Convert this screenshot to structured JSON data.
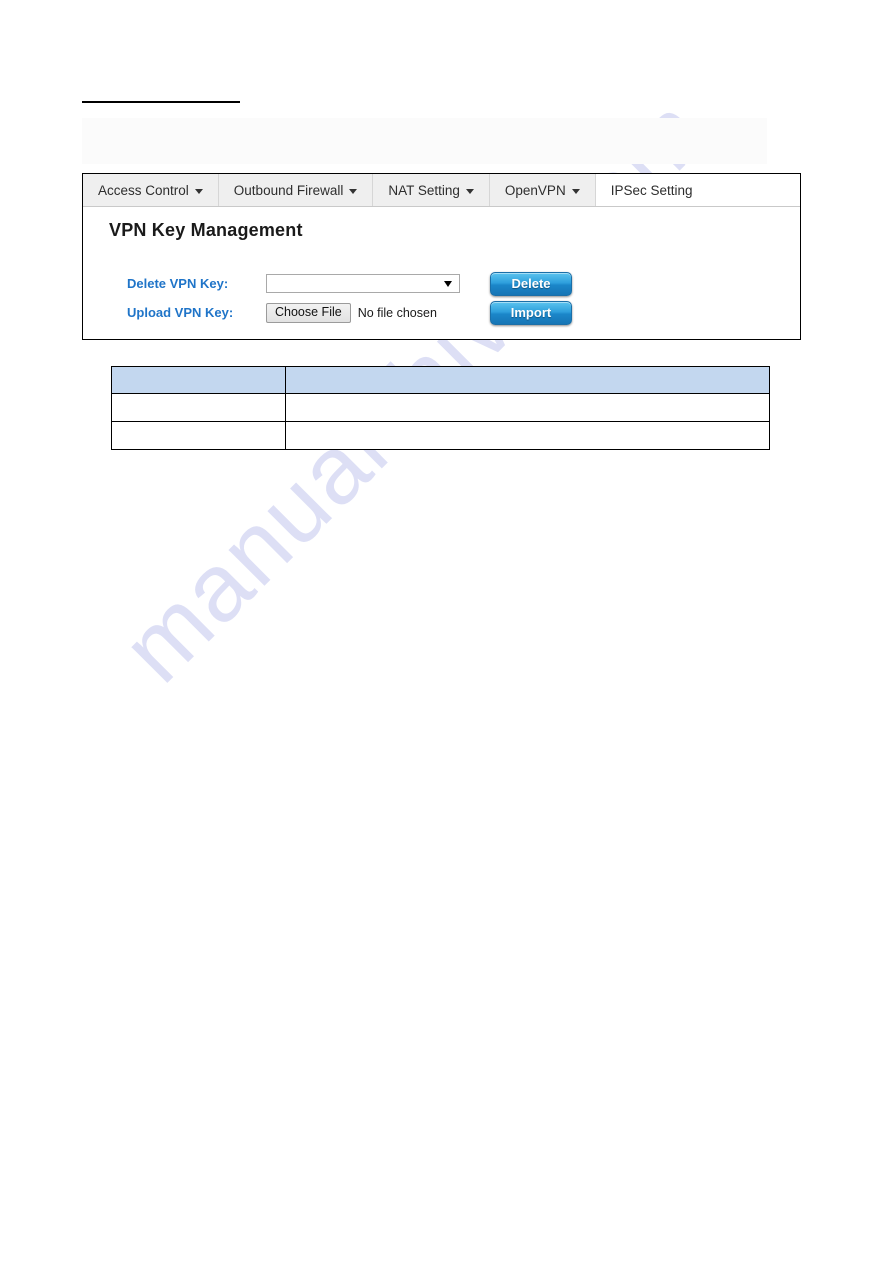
{
  "page": {
    "heading_rule": true,
    "watermark_text": "manualshive.com",
    "watermark_color": "#c9cdf0"
  },
  "panel": {
    "section_title": "VPN Key Management",
    "accent_label_color": "#1f74c8",
    "button_color": "#2e9fdc",
    "tabs": [
      {
        "label": "Access Control",
        "has_caret": true,
        "active": false
      },
      {
        "label": "Outbound Firewall",
        "has_caret": true,
        "active": false
      },
      {
        "label": "NAT Setting",
        "has_caret": true,
        "active": false
      },
      {
        "label": "OpenVPN",
        "has_caret": true,
        "active": false
      },
      {
        "label": "IPSec Setting",
        "has_caret": false,
        "active": true
      }
    ],
    "form": {
      "delete_row": {
        "label": "Delete VPN Key:",
        "select_value": "",
        "button_label": "Delete"
      },
      "upload_row": {
        "label": "Upload VPN Key:",
        "choose_file_label": "Choose File",
        "file_status": "No file chosen",
        "button_label": "Import"
      }
    }
  },
  "description_table": {
    "header_bg": "#c3d7ef",
    "headers": [
      "",
      ""
    ],
    "rows": [
      [
        "",
        ""
      ],
      [
        "",
        ""
      ]
    ]
  }
}
